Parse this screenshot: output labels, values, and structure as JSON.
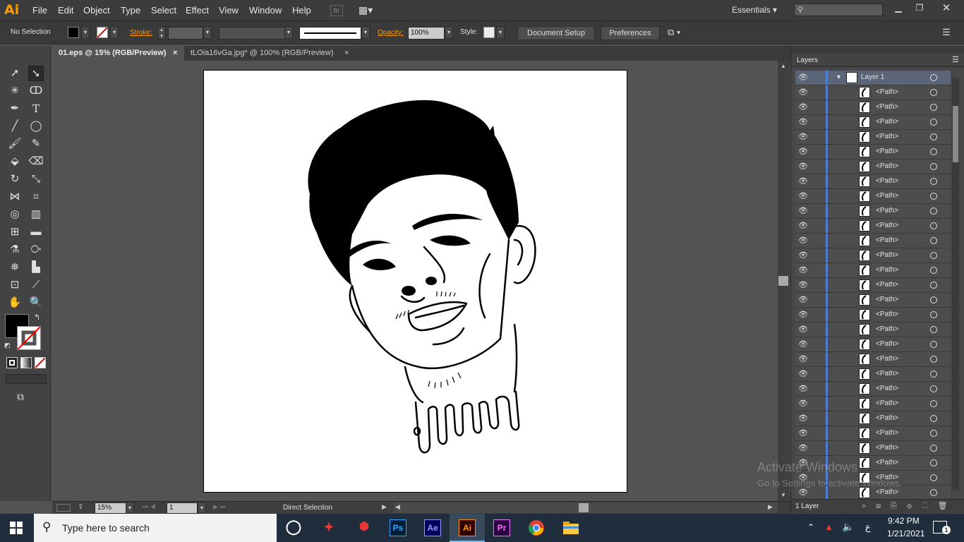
{
  "app": {
    "logo": "Ai",
    "bridge": "Br",
    "workspace": "Essentials"
  },
  "menu": [
    "File",
    "Edit",
    "Object",
    "Type",
    "Select",
    "Effect",
    "View",
    "Window",
    "Help"
  ],
  "control": {
    "selection_label": "No Selection",
    "stroke_label": "Stroke:",
    "opacity_label": "Opacity:",
    "opacity_value": "100%",
    "style_label": "Style:",
    "document_setup": "Document Setup",
    "preferences": "Preferences"
  },
  "tabs": [
    {
      "label": "01.eps @ 15% (RGB/Preview)",
      "active": true
    },
    {
      "label": "tLOia16vGa.jpg* @ 100% (RGB/Preview)",
      "active": false
    }
  ],
  "status": {
    "zoom": "15%",
    "page": "1",
    "tool": "Direct Selection"
  },
  "layers_panel": {
    "title": "Layers",
    "layer_name": "Layer 1",
    "item_label": "<Path>",
    "footer": "1 Layer"
  },
  "paths": [
    "<Path>",
    "<Path>",
    "<Path>",
    "<Path>",
    "<Path>",
    "<Path>",
    "<Path>",
    "<Path>",
    "<Path>",
    "<Path>",
    "<Path>",
    "<Path>",
    "<Path>",
    "<Path>",
    "<Path>",
    "<Path>",
    "<Path>",
    "<Path>",
    "<Path>",
    "<Path>",
    "<Path>",
    "<Path>",
    "<Path>",
    "<Path>",
    "<Path>",
    "<Path>",
    "<Path>",
    "<Path>"
  ],
  "taskbar": {
    "search_placeholder": "Type here to search",
    "apps": [
      "Ps",
      "Ae",
      "Ai",
      "Pr"
    ],
    "time": "9:42 PM",
    "date": "1/21/2021",
    "notif_count": "1",
    "lang": "ع"
  },
  "watermark": {
    "line1": "Activate Windows",
    "line2": "Go to Settings to activate Windows."
  },
  "colors": {
    "accent_orange": "#ff9a00",
    "layer_blue": "#4e7fd8",
    "taskbar": "#1f2d3c"
  }
}
